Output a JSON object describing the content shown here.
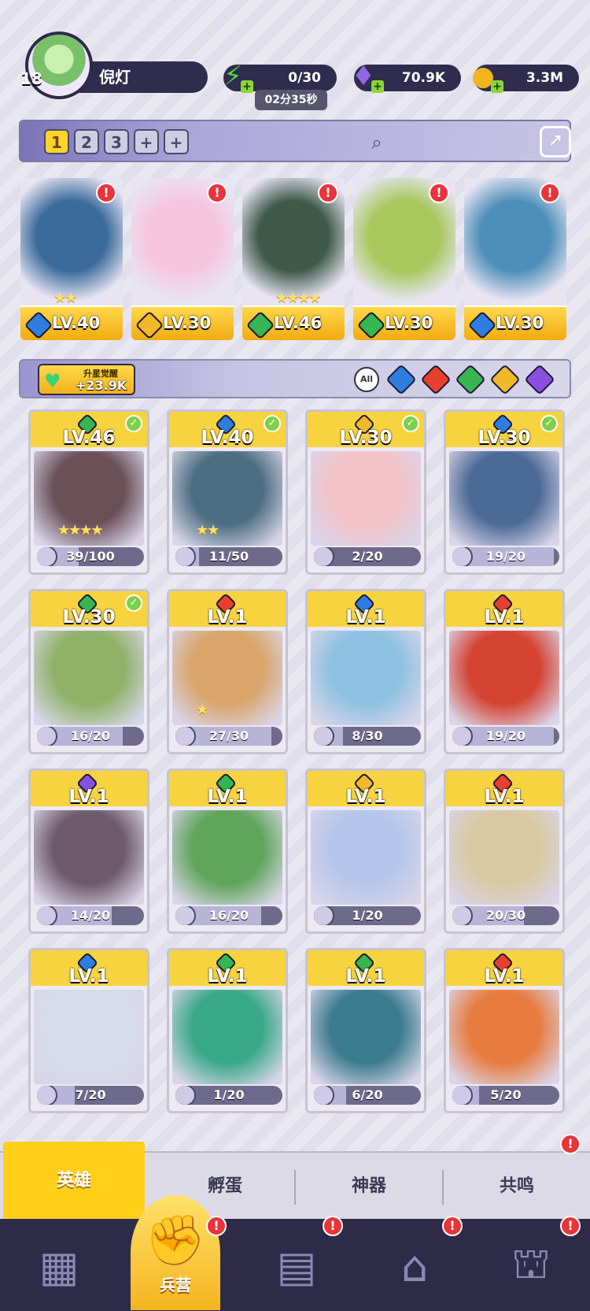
{
  "player": {
    "level": "18",
    "name": "倪灯"
  },
  "resources": {
    "energy": {
      "value": "0/30",
      "timer": "02分35秒",
      "color": "#4fd442",
      "icon": "lightning-icon"
    },
    "gems": {
      "value": "70.9K",
      "color": "#8f67e8",
      "icon": "gem-icon"
    },
    "gold": {
      "value": "3.3M",
      "color": "#f2b51f",
      "icon": "coin-icon"
    }
  },
  "team_tabs": [
    "1",
    "2",
    "3",
    "+",
    "+"
  ],
  "team_slots": [
    {
      "level": "LV.40",
      "element": "water",
      "stars": "★★",
      "alert": "!",
      "color": "#3a6b9a"
    },
    {
      "level": "LV.30",
      "element": "light",
      "stars": "",
      "alert": "!",
      "color": "#f6c6de"
    },
    {
      "level": "LV.46",
      "element": "wind",
      "stars": "★★★★",
      "alert": "!",
      "color": "#3f5a4a"
    },
    {
      "level": "LV.30",
      "element": "wind",
      "stars": "",
      "alert": "!",
      "color": "#a9c85e"
    },
    {
      "level": "LV.30",
      "element": "water",
      "stars": "",
      "alert": "!",
      "color": "#4d8fb8"
    }
  ],
  "awaken": {
    "label": "升星觉醒",
    "value": "+23.9K"
  },
  "filters": {
    "all": "All",
    "elements": [
      "water",
      "fire",
      "wind",
      "light",
      "dark"
    ]
  },
  "element_colors": {
    "water": "#2f7de0",
    "fire": "#e8402f",
    "wind": "#37b552",
    "light": "#f1b82c",
    "dark": "#8b4fe0"
  },
  "heroes": [
    {
      "level": "LV.46",
      "element": "wind",
      "stars": "★★★★",
      "fragments": "39/100",
      "fraction": 0.39,
      "deployed": true,
      "color": "#6b5058"
    },
    {
      "level": "LV.40",
      "element": "water",
      "stars": "★★",
      "fragments": "11/50",
      "fraction": 0.22,
      "deployed": true,
      "color": "#4d6e82"
    },
    {
      "level": "LV.30",
      "element": "light",
      "stars": "",
      "fragments": "2/20",
      "fraction": 0.1,
      "deployed": true,
      "color": "#f3c3c9"
    },
    {
      "level": "LV.30",
      "element": "water",
      "stars": "",
      "fragments": "19/20",
      "fraction": 0.95,
      "deployed": true,
      "color": "#4c6a96"
    },
    {
      "level": "LV.30",
      "element": "wind",
      "stars": "",
      "fragments": "16/20",
      "fraction": 0.8,
      "deployed": true,
      "color": "#8fb268"
    },
    {
      "level": "LV.1",
      "element": "fire",
      "stars": "★",
      "fragments": "27/30",
      "fraction": 0.9,
      "deployed": false,
      "color": "#d9a56a"
    },
    {
      "level": "LV.1",
      "element": "water",
      "stars": "",
      "fragments": "8/30",
      "fraction": 0.27,
      "deployed": false,
      "color": "#8fc2e2"
    },
    {
      "level": "LV.1",
      "element": "fire",
      "stars": "",
      "fragments": "19/20",
      "fraction": 0.95,
      "deployed": false,
      "color": "#d54332"
    },
    {
      "level": "LV.1",
      "element": "dark",
      "stars": "",
      "fragments": "14/20",
      "fraction": 0.7,
      "deployed": false,
      "color": "#6e5a6a"
    },
    {
      "level": "LV.1",
      "element": "wind",
      "stars": "",
      "fragments": "16/20",
      "fraction": 0.8,
      "deployed": false,
      "color": "#5fa55a"
    },
    {
      "level": "LV.1",
      "element": "light",
      "stars": "",
      "fragments": "1/20",
      "fraction": 0.05,
      "deployed": false,
      "color": "#b6c6ea"
    },
    {
      "level": "LV.1",
      "element": "fire",
      "stars": "",
      "fragments": "20/30",
      "fraction": 0.67,
      "deployed": false,
      "color": "#d9c9a2"
    },
    {
      "level": "LV.1",
      "element": "water",
      "stars": "",
      "fragments": "7/20",
      "fraction": 0.35,
      "deployed": false,
      "color": "#d6dceb"
    },
    {
      "level": "LV.1",
      "element": "wind",
      "stars": "",
      "fragments": "1/20",
      "fraction": 0.05,
      "deployed": false,
      "color": "#3aa988"
    },
    {
      "level": "LV.1",
      "element": "wind",
      "stars": "",
      "fragments": "6/20",
      "fraction": 0.3,
      "deployed": false,
      "color": "#3b7c8e"
    },
    {
      "level": "LV.1",
      "element": "fire",
      "stars": "",
      "fragments": "5/20",
      "fraction": 0.25,
      "deployed": false,
      "color": "#e87c40"
    }
  ],
  "subtabs": [
    "英雄",
    "孵蛋",
    "神器",
    "共鸣"
  ],
  "subtab_alert": "!",
  "nav": [
    {
      "icon": "cards-icon",
      "label": "",
      "alert": ""
    },
    {
      "icon": "barracks-icon",
      "label": "兵营",
      "alert": "!"
    },
    {
      "icon": "map-icon",
      "label": "",
      "alert": "!"
    },
    {
      "icon": "temple-icon",
      "label": "",
      "alert": "!"
    },
    {
      "icon": "tower-icon",
      "label": "",
      "alert": "!"
    }
  ]
}
